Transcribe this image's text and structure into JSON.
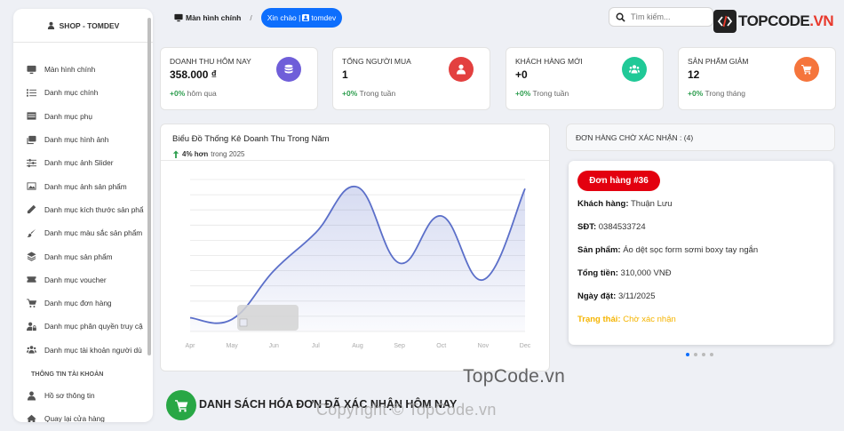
{
  "sidebar": {
    "brand": "SHOP - TOMDEV",
    "items": [
      {
        "label": "Màn hình chính",
        "icon": "monitor-icon"
      },
      {
        "label": "Danh mục chính",
        "icon": "list-icon"
      },
      {
        "label": "Danh mục phụ",
        "icon": "table-icon"
      },
      {
        "label": "Danh mục hình ảnh",
        "icon": "images-icon"
      },
      {
        "label": "Danh mục ảnh Slider",
        "icon": "sliders-icon"
      },
      {
        "label": "Danh mục ảnh sản phẩm",
        "icon": "image-icon"
      },
      {
        "label": "Danh mục kích thước sản phẩ",
        "icon": "pen-icon"
      },
      {
        "label": "Danh mục màu sắc sản phẩm",
        "icon": "paintbrush-icon"
      },
      {
        "label": "Danh mục sản phẩm",
        "icon": "layers-icon"
      },
      {
        "label": "Danh mục voucher",
        "icon": "ticket-icon"
      },
      {
        "label": "Danh mục đơn hàng",
        "icon": "cart-icon"
      },
      {
        "label": "Danh mục phân quyền truy cậ",
        "icon": "user-lock-icon"
      },
      {
        "label": "Danh mục tài khoản người dù",
        "icon": "users-icon"
      }
    ],
    "section_label": "THÔNG TIN TÀI KHOẢN",
    "account_items": [
      {
        "label": "Hồ sơ thông tin",
        "icon": "user-icon"
      },
      {
        "label": "Quay lại cửa hàng",
        "icon": "home-icon"
      }
    ]
  },
  "header": {
    "breadcrumb_home": "Màn hình chính",
    "breadcrumb_separator": "/",
    "greeting_prefix": "Xin chào |",
    "greeting_user": "tomdev",
    "search_placeholder": "Tìm kiếm...",
    "logo_text_main": "TOPCODE",
    "logo_text_accent": ".VN"
  },
  "stats": [
    {
      "title": "Doanh thu hôm nay",
      "value": "358.000 ₫",
      "delta": "+0%",
      "period": "hôm qua",
      "icon": "coins-icon",
      "color": "#6f5ed9"
    },
    {
      "title": "Tổng người mua",
      "value": "1",
      "delta": "+0%",
      "period": "Trong tuần",
      "icon": "user-icon",
      "color": "#e3403f"
    },
    {
      "title": "Khách hàng mới",
      "value": "+0",
      "delta": "+0%",
      "period": "Trong tuần",
      "icon": "users-icon",
      "color": "#20c997"
    },
    {
      "title": "Sản phẩm giảm",
      "value": "12",
      "delta": "+0%",
      "period": "Trong tháng",
      "icon": "cart-icon",
      "color": "#f5753c"
    }
  ],
  "chart_data": {
    "type": "area",
    "title": "Biểu Đồ Thống Kê Doanh Thu Trong Năm",
    "subtitle_bold": "4% hơn",
    "subtitle_rest": "trong 2025",
    "categories": [
      "Apr",
      "May",
      "Jun",
      "Jul",
      "Aug",
      "Sep",
      "Oct",
      "Nov",
      "Dec"
    ],
    "values": [
      0.9,
      0.8,
      4.0,
      6.5,
      9.5,
      4.5,
      7.6,
      3.4,
      9.4
    ],
    "ylim": [
      0,
      10
    ],
    "grid": true,
    "color": "#5b6fc9"
  },
  "orders": {
    "header": "ĐƠN HÀNG CHỜ XÁC NHẬN : (4)",
    "badge": "Đơn hàng #36",
    "customer_label": "Khách hàng:",
    "customer_value": "Thuận Lưu",
    "phone_label": "SĐT:",
    "phone_value": "0384533724",
    "product_label": "Sản phẩm:",
    "product_value": "Áo dệt sọc form sơmi boxy tay ngắn",
    "total_label": "Tổng tiền:",
    "total_value": "310,000 VNĐ",
    "date_label": "Ngày đặt:",
    "date_value": "3/11/2025",
    "status_label": "Trạng thái:",
    "status_value": "Chờ xác nhận"
  },
  "bottom": {
    "title": "DANH SÁCH HÓA ĐƠN ĐÃ XÁC NHẬN HÔM NAY"
  },
  "watermarks": {
    "primary": "TopCode.vn",
    "secondary": "Copyright © TopCode.vn"
  }
}
